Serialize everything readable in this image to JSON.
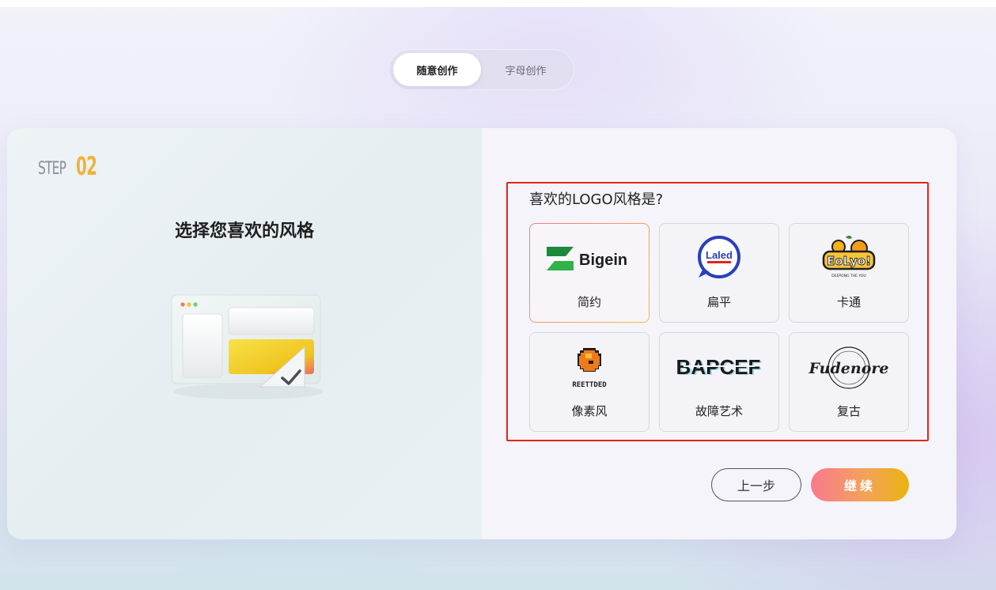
{
  "tabs": [
    {
      "label": "随意创作",
      "active": true
    },
    {
      "label": "字母创作",
      "active": false
    }
  ],
  "step": {
    "word": "STEP",
    "number": "02"
  },
  "left_title": "选择您喜欢的风格",
  "question": "喜欢的LOGO风格是?",
  "options": [
    {
      "label": "简约",
      "logo_text": "Bigein",
      "selected": true
    },
    {
      "label": "扁平",
      "logo_text": "Laled",
      "selected": false
    },
    {
      "label": "卡通",
      "logo_text": "EoLyo!",
      "logo_subtext": "DEEPONG THE YOU",
      "selected": false
    },
    {
      "label": "像素风",
      "logo_text": "REETTDED",
      "selected": false
    },
    {
      "label": "故障艺术",
      "logo_text": "BAPCEF",
      "selected": false
    },
    {
      "label": "复古",
      "logo_text": "Fudenore",
      "selected": false
    }
  ],
  "buttons": {
    "prev": "上一步",
    "next": "继续"
  },
  "colors": {
    "accent_gradient_start": "#f97a8e",
    "accent_gradient_end": "#e9b40e",
    "highlight_frame": "#e2231a",
    "step_number": "#f0b23a"
  }
}
